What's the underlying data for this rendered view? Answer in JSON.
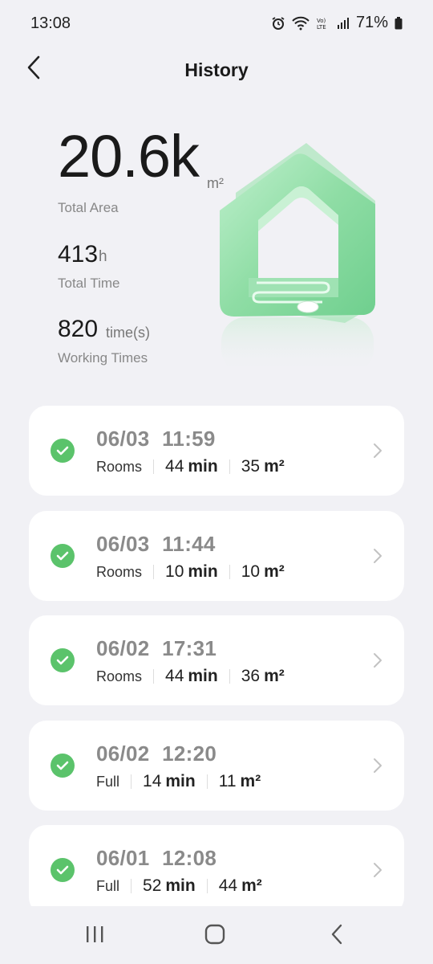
{
  "status_bar": {
    "time": "13:08",
    "battery": "71%",
    "icons": [
      "alarm-icon",
      "wifi-icon",
      "volte-icon",
      "signal-icon",
      "battery-icon"
    ]
  },
  "header": {
    "title": "History",
    "back_icon": "chevron-left-icon"
  },
  "stats": {
    "total_area_value": "20.6k",
    "total_area_unit": "m²",
    "total_area_label": "Total Area",
    "total_time_value": "413",
    "total_time_unit": "h",
    "total_time_label": "Total Time",
    "working_times_value": "820",
    "working_times_unit": "time(s)",
    "working_times_label": "Working Times"
  },
  "colors": {
    "accent_green": "#5bc36b",
    "background": "#f1f1f5",
    "card": "#ffffff"
  },
  "records": [
    {
      "date": "06/03",
      "time": "11:59",
      "mode": "Rooms",
      "duration": "44",
      "duration_unit": "min",
      "area": "35",
      "area_unit": "m²"
    },
    {
      "date": "06/03",
      "time": "11:44",
      "mode": "Rooms",
      "duration": "10",
      "duration_unit": "min",
      "area": "10",
      "area_unit": "m²"
    },
    {
      "date": "06/02",
      "time": "17:31",
      "mode": "Rooms",
      "duration": "44",
      "duration_unit": "min",
      "area": "36",
      "area_unit": "m²"
    },
    {
      "date": "06/02",
      "time": "12:20",
      "mode": "Full",
      "duration": "14",
      "duration_unit": "min",
      "area": "11",
      "area_unit": "m²"
    },
    {
      "date": "06/01",
      "time": "12:08",
      "mode": "Full",
      "duration": "52",
      "duration_unit": "min",
      "area": "44",
      "area_unit": "m²"
    }
  ],
  "nav": {
    "recents_icon": "recents-icon",
    "home_icon": "home-icon",
    "back_icon": "back-icon"
  }
}
